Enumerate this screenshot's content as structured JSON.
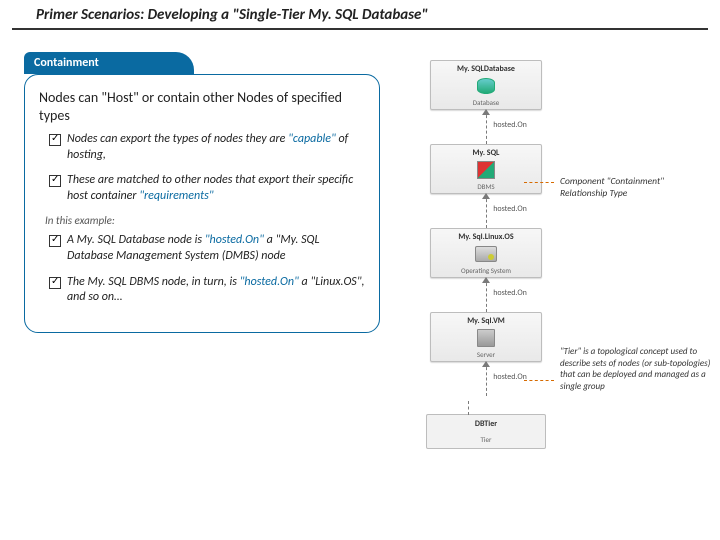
{
  "title": "Primer Scenarios: Developing a \"Single-Tier My. SQL Database\"",
  "tab": "Containment",
  "lead": "Nodes can \"Host\" or contain other Nodes of specified types",
  "bullets": {
    "b1a": "Nodes can export the types of nodes they are ",
    "b1b": "\"capable\"",
    "b1c": " of hosting,",
    "b2a": "These are matched to other nodes that export their specific host container ",
    "b2b": "\"requirements\""
  },
  "subhead": "In this example:",
  "ex": {
    "e1a": "A My. SQL Database node is ",
    "e1b": "\"hosted.On\"",
    "e1c": " a \"My. SQL Database Management System (DMBS) node",
    "e2a": "The My. SQL DBMS node, in turn, is ",
    "e2b": "\"hosted.On\"",
    "e2c": " a \"Linux.OS\", and so on…"
  },
  "nodes": {
    "n1": {
      "name": "My. SQLDatabase",
      "sub": "Database"
    },
    "n2": {
      "name": "My. SQL",
      "sub": "DBMS"
    },
    "n3": {
      "name": "My. Sql.Linux.OS",
      "sub": "Operating System"
    },
    "n4": {
      "name": "My. Sql.VM",
      "sub": "Server"
    },
    "tier": {
      "name": "DBTier",
      "sub": "Tier"
    }
  },
  "edge_label": "hosted.On",
  "callouts": {
    "c1": "Component \"Containment\" Relationship Type",
    "c2": "\"Tier\" is a topological concept used to describe sets of nodes (or sub-topologies) that can be deployed and managed as a single group"
  }
}
